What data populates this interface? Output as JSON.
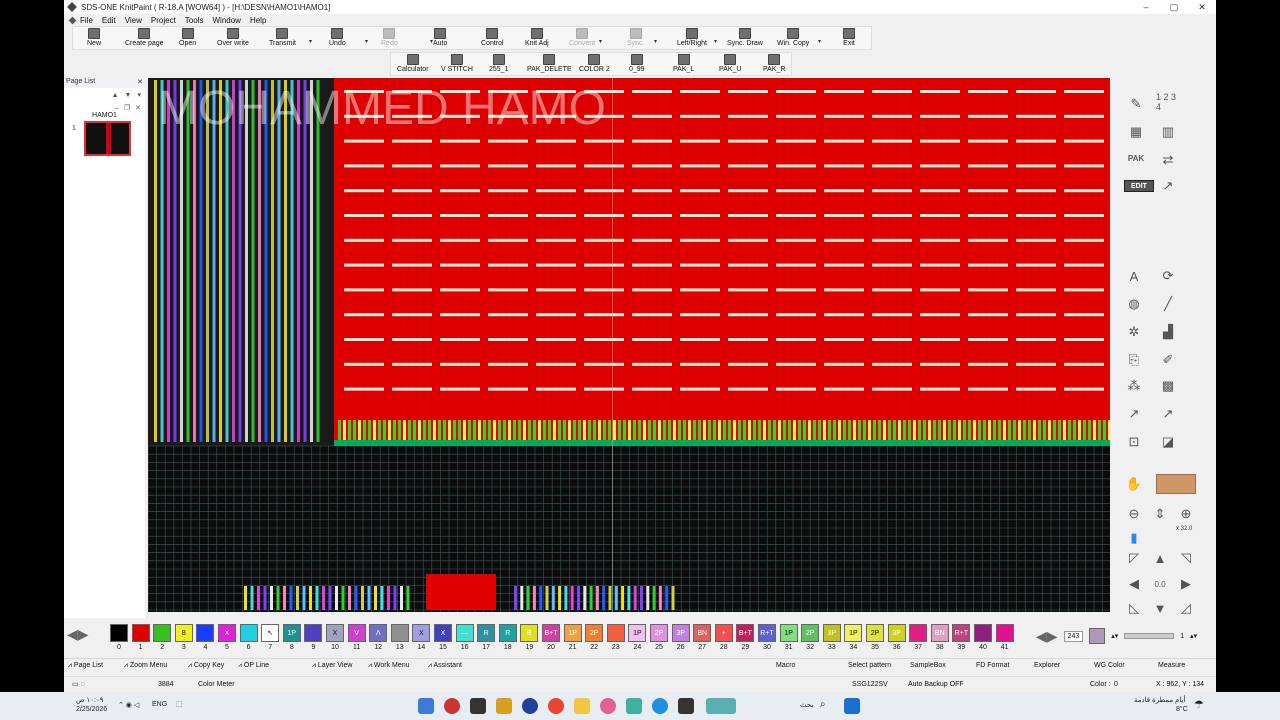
{
  "window": {
    "title": "SDS-ONE KnitPaint ( R-18.A [WOW64] ) - [H:\\DESN\\HAMO1\\HAMO1]",
    "controls": [
      "–",
      "▢",
      "✕"
    ]
  },
  "menu": [
    "File",
    "Edit",
    "View",
    "Project",
    "Tools",
    "Window",
    "Help"
  ],
  "toolbar_main": [
    {
      "label": "New",
      "icon": "new-file-icon",
      "disabled": false
    },
    {
      "label": "Create page",
      "icon": "create-page-icon",
      "disabled": false
    },
    {
      "label": "Open",
      "icon": "open-folder-icon",
      "disabled": false
    },
    {
      "label": "Over write",
      "icon": "save-icon",
      "disabled": false
    },
    {
      "label": "Transmit",
      "icon": "transmit-icon",
      "disabled": false
    },
    {
      "label": "Undo",
      "icon": "undo-icon",
      "disabled": false
    },
    {
      "label": "Redo",
      "icon": "redo-icon",
      "disabled": true
    },
    {
      "label": "Auto",
      "icon": "auto-icon",
      "disabled": false
    },
    {
      "label": "Control",
      "icon": "control-icon",
      "disabled": false
    },
    {
      "label": "Knit Adj",
      "icon": "knit-adjust-icon",
      "disabled": false
    },
    {
      "label": "Convent",
      "icon": "convert-icon",
      "disabled": true
    },
    {
      "label": "Sync.",
      "icon": "sync-icon",
      "disabled": true
    },
    {
      "label": "Left/Right",
      "icon": "left-right-icon",
      "disabled": false
    },
    {
      "label": "Sync. Draw",
      "icon": "sync-draw-icon",
      "disabled": false
    },
    {
      "label": "Win. Copy",
      "icon": "window-copy-icon",
      "disabled": false
    },
    {
      "label": "Exit",
      "icon": "exit-icon",
      "disabled": false
    }
  ],
  "toolbar_macro": [
    {
      "label": "Calculator",
      "icon": "calculator-icon"
    },
    {
      "label": "V STITCH",
      "icon": "v-stitch-icon"
    },
    {
      "label": "255_1",
      "icon": "macro-255-icon"
    },
    {
      "label": "PAK_DELETE",
      "icon": "pak-delete-icon"
    },
    {
      "label": "COLOR 2",
      "icon": "color2-icon"
    },
    {
      "label": "0_99",
      "icon": "macro-099-icon"
    },
    {
      "label": "PAK_L",
      "icon": "pak-l-icon"
    },
    {
      "label": "PAK_U",
      "icon": "pak-u-icon"
    },
    {
      "label": "PAK_R",
      "icon": "pak-r-icon"
    }
  ],
  "page_list": {
    "title": "Page List",
    "file_name": "HAMO1",
    "page_number": "1"
  },
  "canvas": {
    "watermark": "MOHAMMED HAMO",
    "colors": {
      "red": "#e00000",
      "dark": "#1a1a1a",
      "grid": "#3a5a58",
      "white_stitch": "#f2ead8",
      "green": "#39d414"
    }
  },
  "right_tools": {
    "edit_label": "EDIT",
    "pak_label": "PAK",
    "numbers_label": "1 2 3 4",
    "zoom_level": "x 32.0"
  },
  "palette": {
    "swatches": [
      {
        "n": "0",
        "color": "#000000",
        "text": ""
      },
      {
        "n": "1",
        "color": "#e00000",
        "text": ""
      },
      {
        "n": "2",
        "color": "#39c020",
        "text": ""
      },
      {
        "n": "3",
        "color": "#f0f020",
        "text": "8"
      },
      {
        "n": "4",
        "color": "#1c3cff",
        "text": ""
      },
      {
        "n": "5",
        "color": "#e020e0",
        "text": "X"
      },
      {
        "n": "6",
        "color": "#20d0e0",
        "text": ""
      },
      {
        "n": "7",
        "color": "#ffffff",
        "text": "↖"
      },
      {
        "n": "8",
        "color": "#209090",
        "text": "1P"
      },
      {
        "n": "9",
        "color": "#5040c0",
        "text": ""
      },
      {
        "n": "10",
        "color": "#a0a0c0",
        "text": "X"
      },
      {
        "n": "11",
        "color": "#d040d0",
        "text": "V"
      },
      {
        "n": "12",
        "color": "#7070c0",
        "text": "Λ"
      },
      {
        "n": "13",
        "color": "#909090",
        "text": ""
      },
      {
        "n": "14",
        "color": "#a0a0e0",
        "text": "X"
      },
      {
        "n": "15",
        "color": "#4040c0",
        "text": "X"
      },
      {
        "n": "16",
        "color": "#40e0d0",
        "text": "—"
      },
      {
        "n": "17",
        "color": "#3090a0",
        "text": "R"
      },
      {
        "n": "18",
        "color": "#20a0a0",
        "text": "R"
      },
      {
        "n": "19",
        "color": "#e0e020",
        "text": "B"
      },
      {
        "n": "20",
        "color": "#d040a0",
        "text": "B+T"
      },
      {
        "n": "21",
        "color": "#f0a040",
        "text": "1P"
      },
      {
        "n": "22",
        "color": "#f08030",
        "text": "2P"
      },
      {
        "n": "23",
        "color": "#f06040",
        "text": ""
      },
      {
        "n": "24",
        "color": "#f0c0f0",
        "text": "1P"
      },
      {
        "n": "25",
        "color": "#e090e0",
        "text": "2P"
      },
      {
        "n": "26",
        "color": "#c080e0",
        "text": "3P"
      },
      {
        "n": "27",
        "color": "#e06060",
        "text": "BN"
      },
      {
        "n": "28",
        "color": "#f05050",
        "text": "+"
      },
      {
        "n": "29",
        "color": "#c02060",
        "text": "B+T"
      },
      {
        "n": "30",
        "color": "#6060d0",
        "text": "R+T"
      },
      {
        "n": "31",
        "color": "#80e080",
        "text": "1P"
      },
      {
        "n": "32",
        "color": "#60c060",
        "text": "2P"
      },
      {
        "n": "33",
        "color": "#c0c020",
        "text": "3P"
      },
      {
        "n": "34",
        "color": "#f0f060",
        "text": "1P"
      },
      {
        "n": "35",
        "color": "#e0e040",
        "text": "2P"
      },
      {
        "n": "36",
        "color": "#d0d020",
        "text": "3P"
      },
      {
        "n": "37",
        "color": "#e02080",
        "text": ""
      },
      {
        "n": "38",
        "color": "#e0a0c0",
        "text": "BN"
      },
      {
        "n": "39",
        "color": "#c04080",
        "text": "R+T"
      },
      {
        "n": "40",
        "color": "#902080",
        "text": ""
      },
      {
        "n": "41",
        "color": "#e01090",
        "text": ""
      }
    ],
    "count_value": "243",
    "layer_value": "1"
  },
  "status_bar": {
    "items": [
      "Page List",
      "Zoom Menu",
      "Copy Key",
      "OP Line",
      "Layer View",
      "Work Menu",
      "Assistant"
    ],
    "macro": "Macro",
    "right_items": [
      "Select pattern",
      "SampleBox",
      "FD Format",
      "Explorer",
      "WG Color",
      "Measure"
    ]
  },
  "info_bar": {
    "size_value": "3884",
    "color_meter": "Color Meter",
    "machine": "SSG122SV",
    "backup": "Auto Backup OFF",
    "color_label": "Color :",
    "color_value": "0",
    "coords": "X : 962, Y : 134"
  },
  "taskbar": {
    "time": "١٠:٠٩ ص",
    "date": "2/25/2026",
    "lang": "ENG",
    "search_placeholder": "بحث",
    "weather": "أيام ممطرة قادمة",
    "temp": "8°C"
  }
}
